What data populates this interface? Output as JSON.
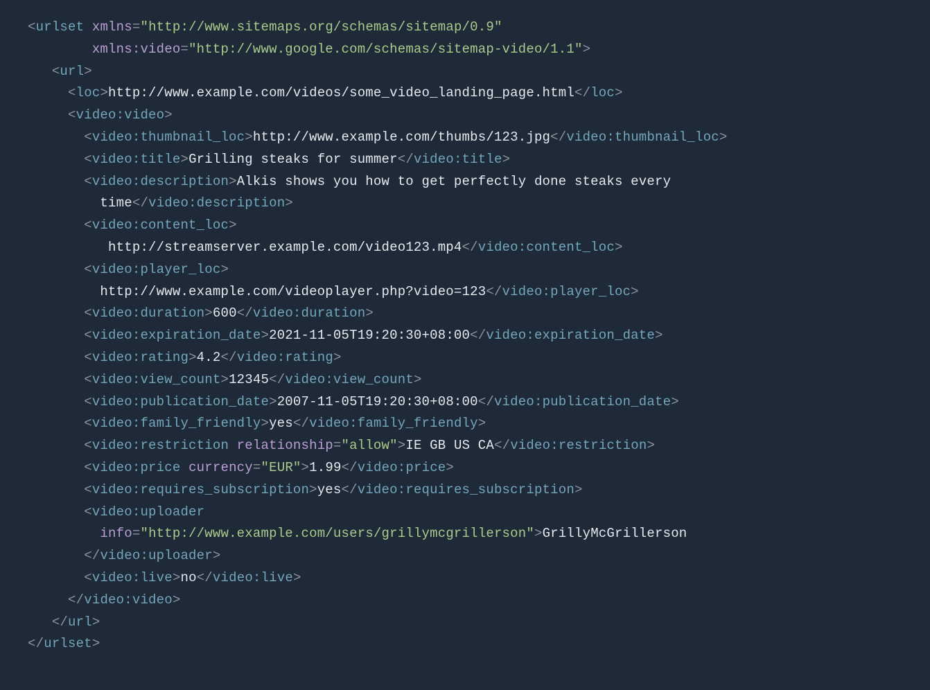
{
  "xmlns": "http://www.sitemaps.org/schemas/sitemap/0.9",
  "xmlns_video": "http://www.google.com/schemas/sitemap-video/1.1",
  "loc": "http://www.example.com/videos/some_video_landing_page.html",
  "thumbnail_loc": "http://www.example.com/thumbs/123.jpg",
  "title": "Grilling steaks for summer",
  "description_line1": "Alkis shows you how to get perfectly done steaks every",
  "description_line2": "time",
  "content_loc": "http://streamserver.example.com/video123.mp4",
  "player_loc": "http://www.example.com/videoplayer.php?video=123",
  "duration": "600",
  "expiration_date": "2021-11-05T19:20:30+08:00",
  "rating": "4.2",
  "view_count": "12345",
  "publication_date": "2007-11-05T19:20:30+08:00",
  "family_friendly": "yes",
  "restriction_relationship": "allow",
  "restriction": "IE GB US CA",
  "price_currency": "EUR",
  "price": "1.99",
  "requires_subscription": "yes",
  "uploader_info": "http://www.example.com/users/grillymcgrillerson",
  "uploader": "GrillyMcGrillerson",
  "live": "no",
  "tags": {
    "urlset": "urlset",
    "xmlns": "xmlns",
    "xmlns_video": "xmlns:video",
    "url": "url",
    "loc": "loc",
    "video_video": "video:video",
    "video_thumbnail_loc": "video:thumbnail_loc",
    "video_title": "video:title",
    "video_description": "video:description",
    "video_content_loc": "video:content_loc",
    "video_player_loc": "video:player_loc",
    "video_duration": "video:duration",
    "video_expiration_date": "video:expiration_date",
    "video_rating": "video:rating",
    "video_view_count": "video:view_count",
    "video_publication_date": "video:publication_date",
    "video_family_friendly": "video:family_friendly",
    "video_restriction": "video:restriction",
    "relationship": "relationship",
    "video_price": "video:price",
    "currency": "currency",
    "video_requires_subscription": "video:requires_subscription",
    "video_uploader": "video:uploader",
    "info": "info",
    "video_live": "video:live"
  }
}
